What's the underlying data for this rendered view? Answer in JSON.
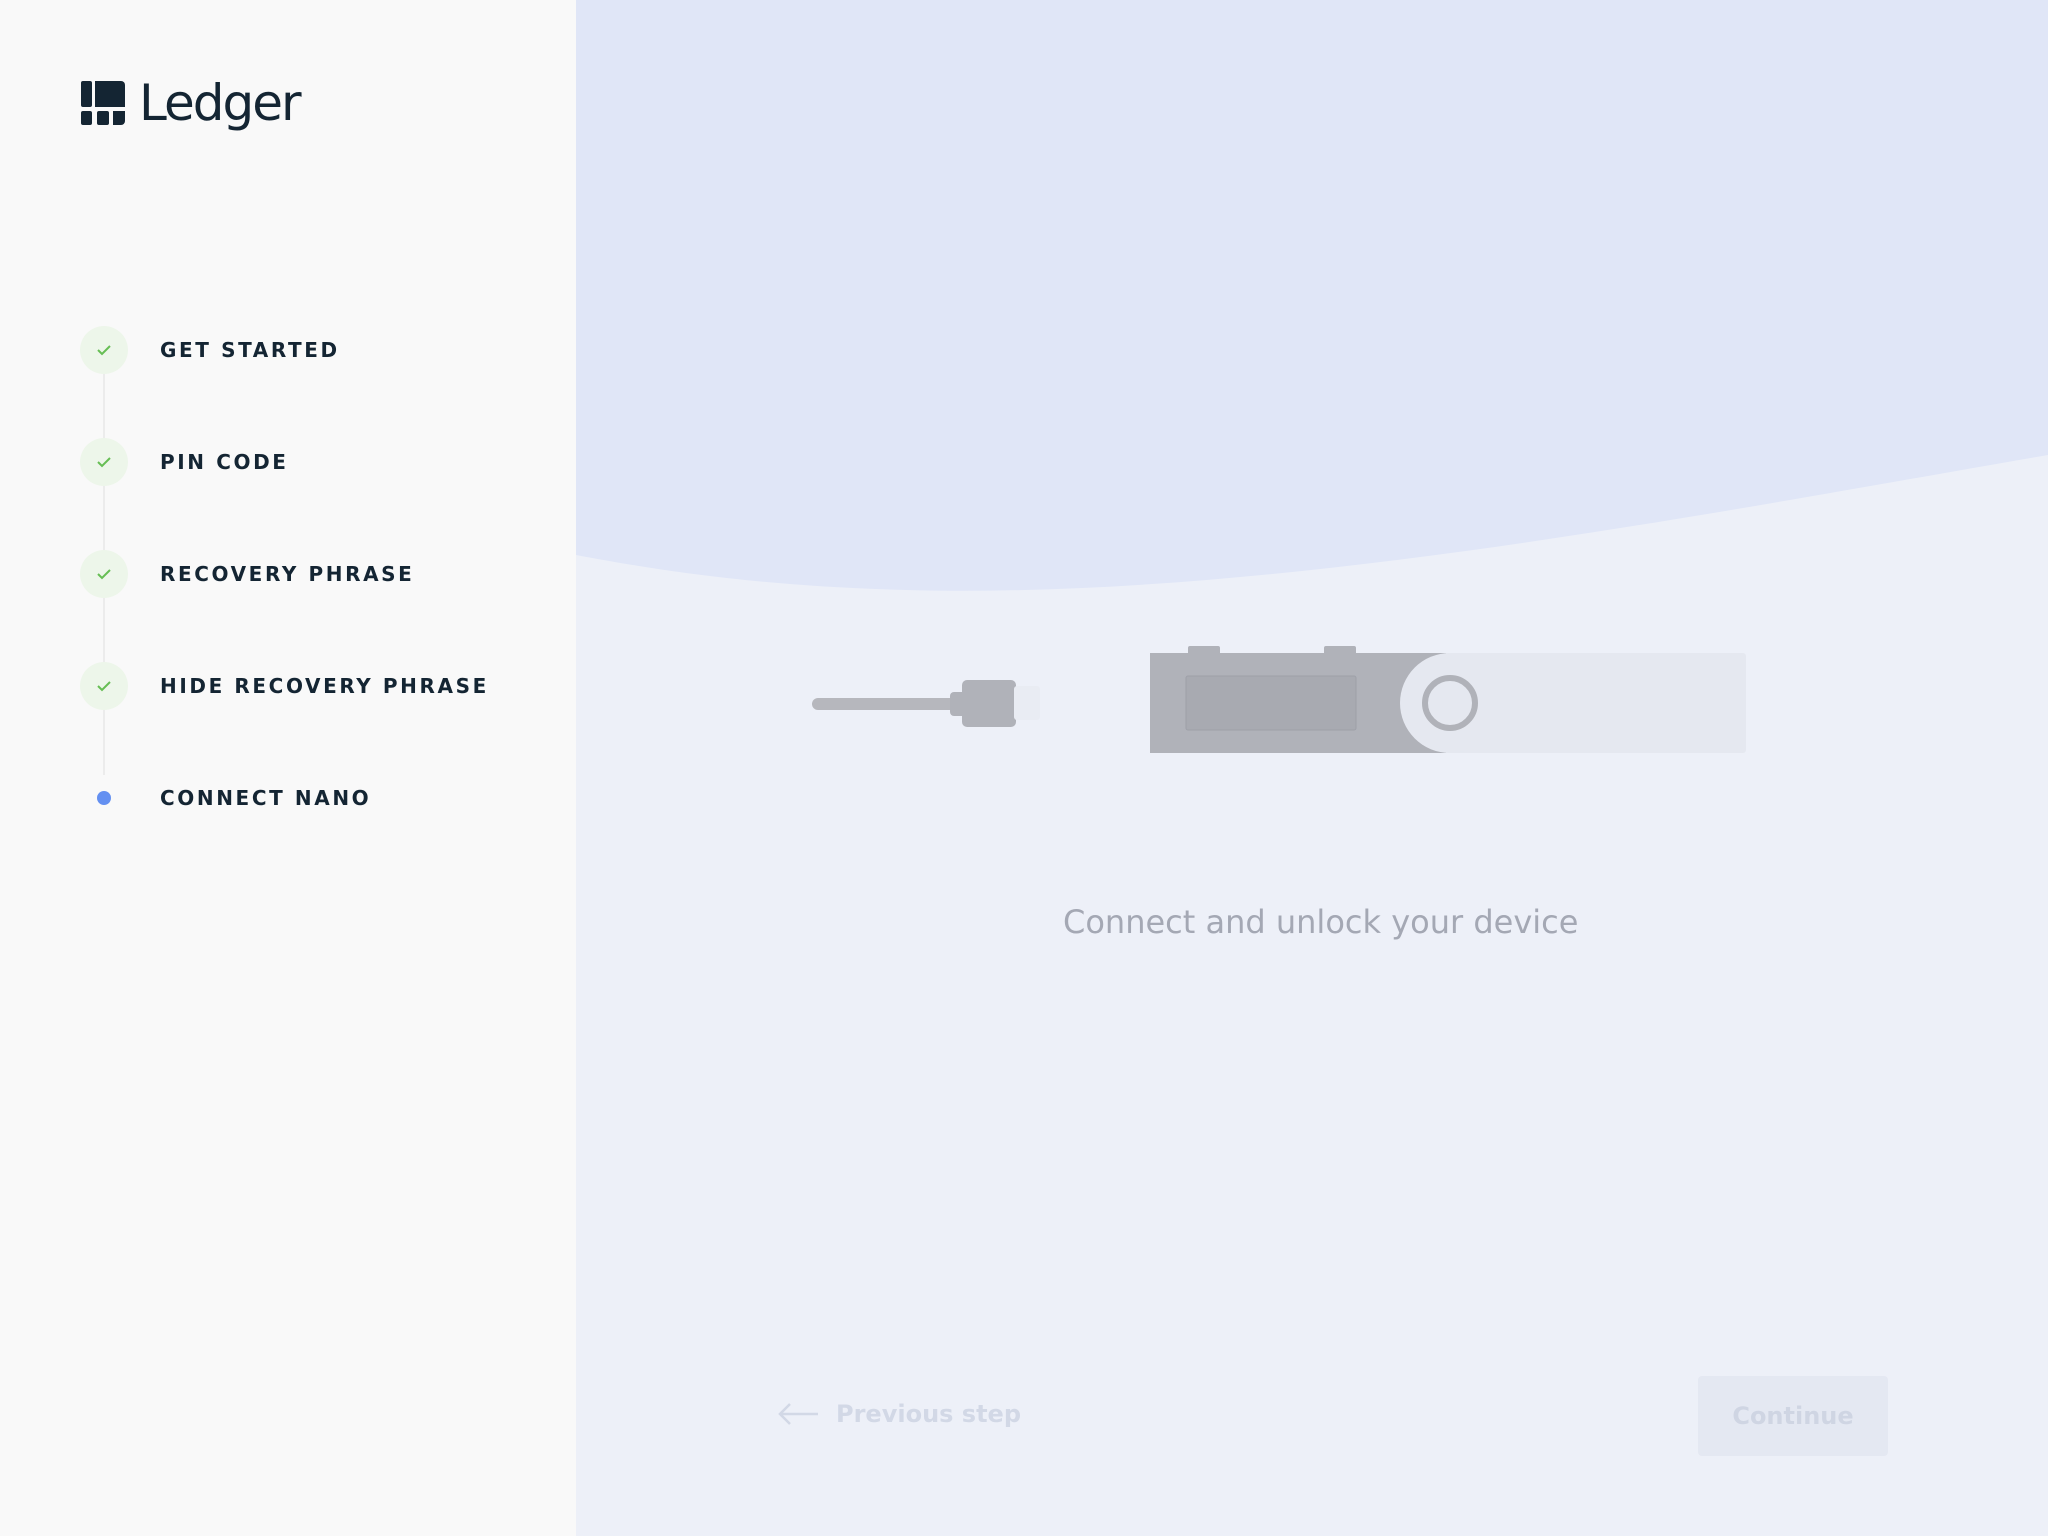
{
  "brand": {
    "name": "Ledger"
  },
  "steps": [
    {
      "label": "GET STARTED",
      "status": "done"
    },
    {
      "label": "PIN CODE",
      "status": "done"
    },
    {
      "label": "RECOVERY PHRASE",
      "status": "done"
    },
    {
      "label": "HIDE RECOVERY PHRASE",
      "status": "done"
    },
    {
      "label": "CONNECT NANO",
      "status": "current"
    }
  ],
  "main": {
    "title": "Connect and unlock your device",
    "previous_label": "Previous step",
    "continue_label": "Continue"
  },
  "colors": {
    "done_check": "#66be54",
    "current_dot": "#6490f1",
    "wave": "#e0e6f7",
    "background": "#edf0f8"
  }
}
